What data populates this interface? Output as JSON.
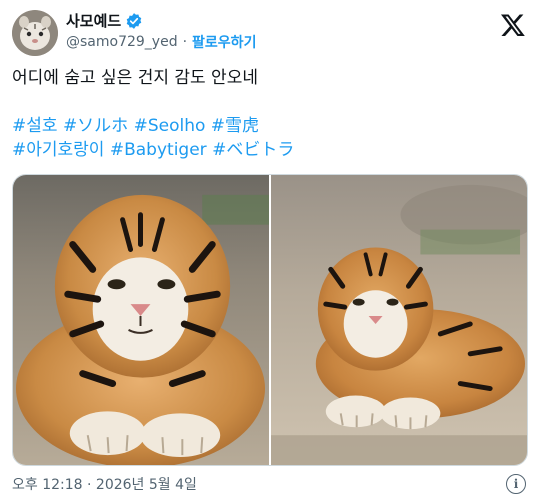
{
  "user": {
    "display_name": "사모예드",
    "handle": "@samo729_yed",
    "separator": "·",
    "follow_label": "팔로우하기"
  },
  "tweet": {
    "text_line": "어디에 숨고 싶은 건지 감도 안오네",
    "hashtags_line1": [
      "#설호",
      "#ソルホ",
      "#Seolho",
      "#雪虎"
    ],
    "hashtags_line2": [
      "#아기호랑이",
      "#Babytiger",
      "#ベビトラ"
    ]
  },
  "media": {
    "images": [
      "tiger-photo-1",
      "tiger-photo-2"
    ]
  },
  "footer": {
    "timestamp": "오후 12:18 · 2026년 5월 4일",
    "info_glyph": "i"
  },
  "colors": {
    "accent": "#1d9bf0",
    "text": "#0f1419",
    "muted": "#536471"
  },
  "icons": {
    "verified": "verified-badge-icon",
    "logo": "x-logo-icon",
    "info": "info-icon"
  }
}
